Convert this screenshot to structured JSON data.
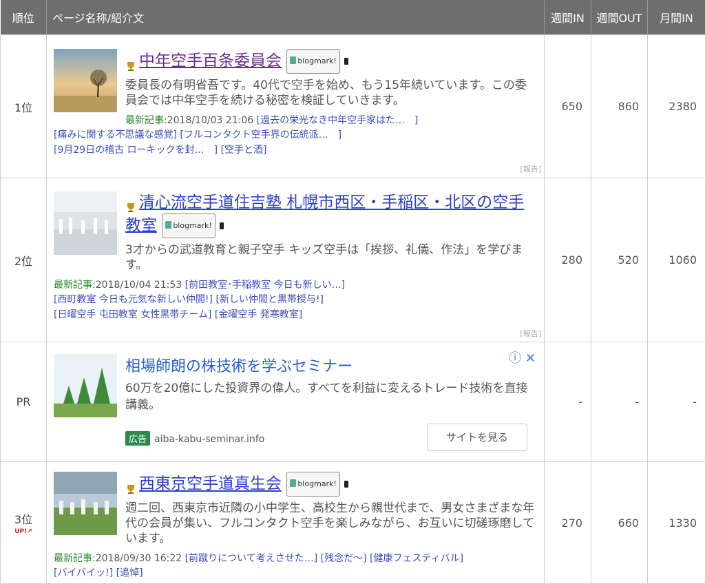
{
  "header": {
    "rank": "順位",
    "name": "ページ名称/紹介文",
    "week_in": "週間IN",
    "week_out": "週間OUT",
    "month_in": "月間IN"
  },
  "rows": [
    {
      "rank": "1位",
      "title": "中年空手百条委員会",
      "bookmark_label": "blogmark!",
      "desc": "委員長の有明省吾です。40代で空手を始め、もう15年続いています。この委員会では中年空手を続ける秘密を検証していきます。",
      "latest_label": "最新記事",
      "latest_date": ":2018/10/03 21:06",
      "articles": [
        "[過去の栄光なき中年空手家はた…　]",
        "[痛みに関する不思議な感覚]",
        "[フルコンタクト空手界の伝統派…　]",
        "[9月29日の稽古 ローキックを封…　]",
        "[空手と酒]"
      ],
      "report": "[報告]",
      "week_in": "650",
      "week_out": "860",
      "month_in": "2380"
    },
    {
      "rank": "2位",
      "title": "清心流空手道住吉塾 札幌市西区・手稲区・北区の空手教室",
      "bookmark_label": "blogmark!",
      "desc": "3才からの武道教育と親子空手 キッズ空手は「挨拶、礼儀、作法」を学びます。",
      "latest_label": "最新記事",
      "latest_date": ":2018/10/04 21:53",
      "articles": [
        "[前田教室･手稲教室 今日も新しい…]",
        "[西町教室 今日も元気な新しい仲間!]",
        "[新しい仲間と黒帯授与!]",
        "[日曜空手 屯田教室 女性黒帯チーム]",
        "[金曜空手 発寒教室]"
      ],
      "report": "[報告]",
      "week_in": "280",
      "week_out": "520",
      "month_in": "1060"
    },
    {
      "rank": "PR",
      "title": "相場師朗の株技術を学ぶセミナー",
      "desc": "60万を20億にした投資界の偉人。すべてを利益に変えるトレード技術を直接講義。",
      "ad_badge": "広告",
      "ad_url": "aiba-kabu-seminar.info",
      "button": "サイトを見る",
      "week_in": "-",
      "week_out": "-",
      "month_in": "-"
    },
    {
      "rank": "3位",
      "up": "UP!↗",
      "title": "西東京空手道真生会",
      "bookmark_label": "blogmark!",
      "desc": "週二回、西東京市近隣の小中学生、高校生から親世代まで、男女さまざまな年代の会員が集い、フルコンタクト空手を楽しみながら、お互いに切磋琢磨しています。",
      "latest_label": "最新記事",
      "latest_date": ":2018/09/30 16:22",
      "articles": [
        "[前蹴りについて考えさせた…]",
        "[残念だ〜]",
        "[健康フェスティバル]",
        "[バイバイッ!]",
        "[追悼]"
      ],
      "week_in": "270",
      "week_out": "660",
      "month_in": "1330"
    }
  ],
  "colors": {
    "header_bg": "#6e6e6e",
    "link": "#2b3fcf",
    "visited": "#6a2d8f",
    "latest_green": "#2a8a2a",
    "ad_title": "#2a5fd1"
  },
  "icons": [
    "trophy-icon",
    "blogmark-icon",
    "mobile-icon",
    "info-icon",
    "close-icon",
    "up-arrow-icon"
  ]
}
